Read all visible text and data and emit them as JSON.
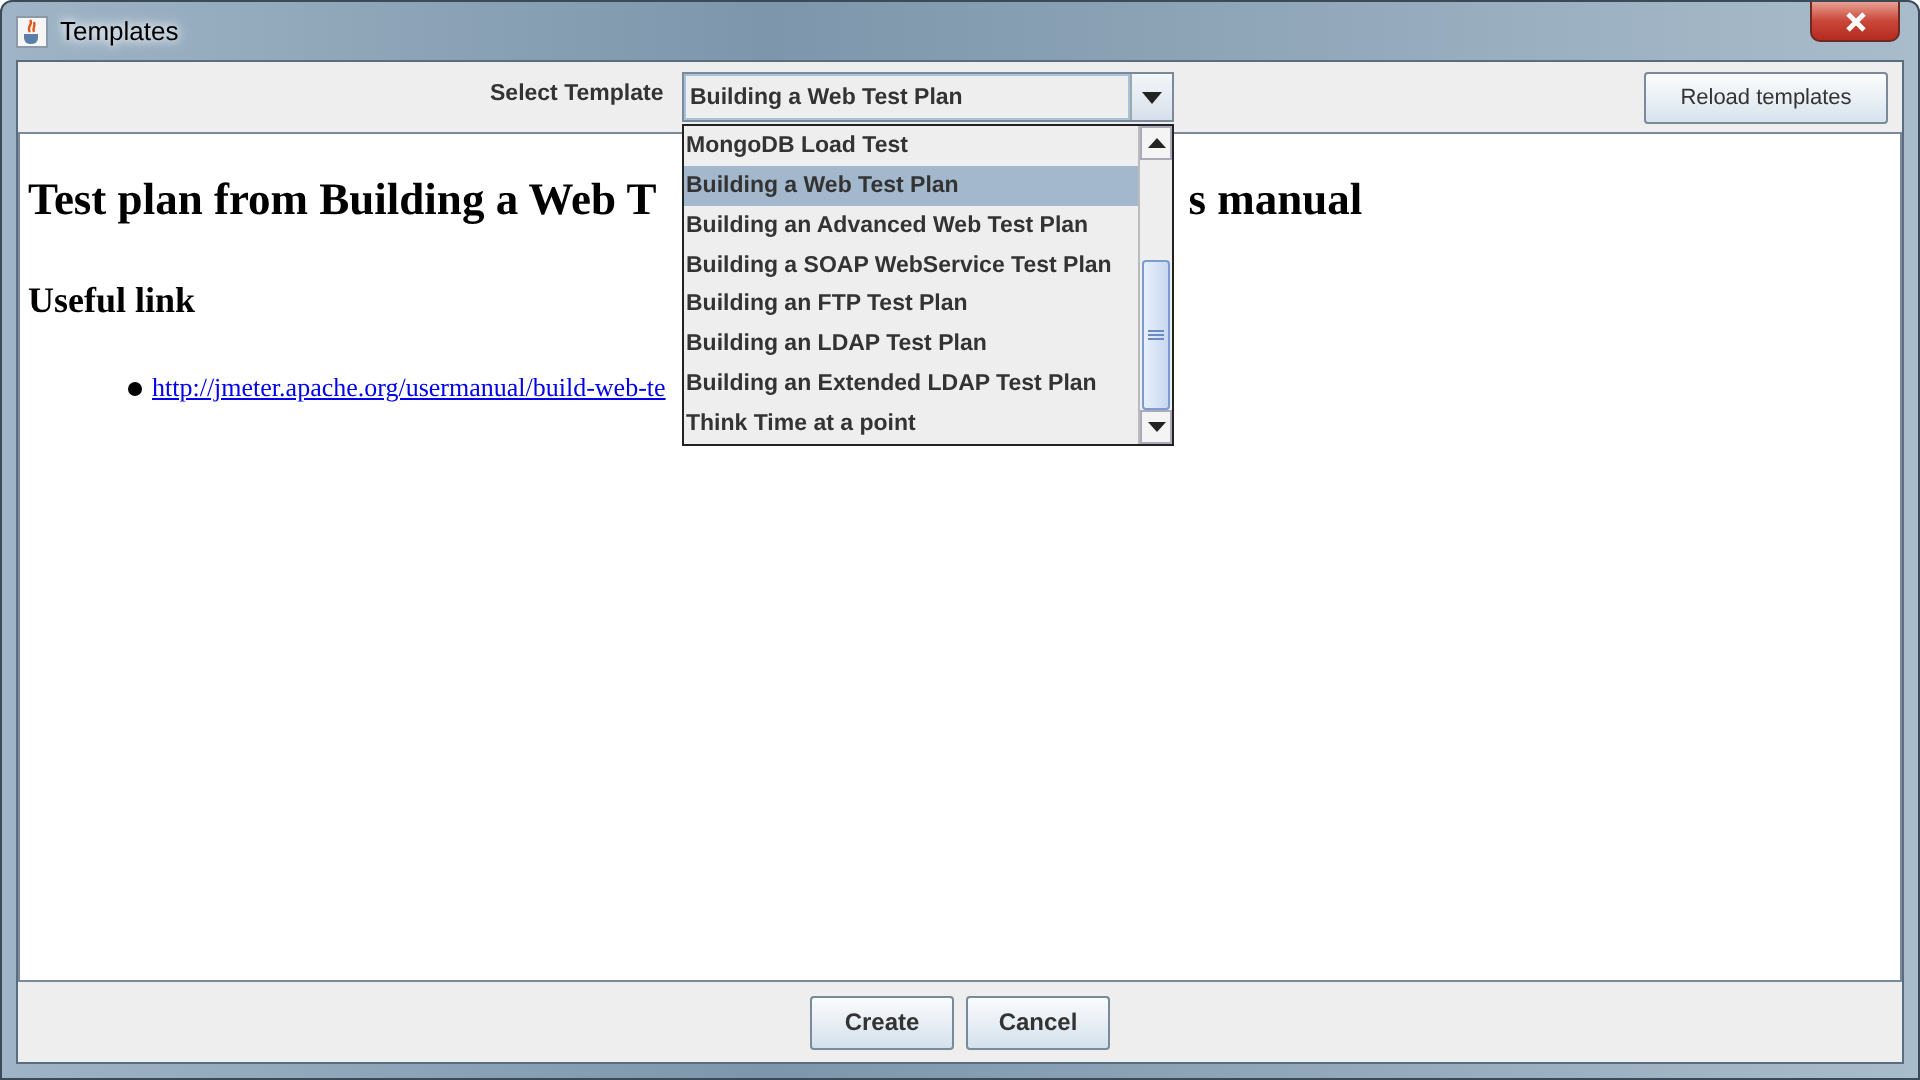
{
  "window": {
    "title": "Templates"
  },
  "toolbar": {
    "label": "Select Template",
    "combo_value": "Building a Web Test Plan",
    "reload_button": "Reload templates"
  },
  "dropdown": {
    "items": [
      {
        "label": "MongoDB Load Test",
        "selected": false
      },
      {
        "label": "Building a Web Test Plan",
        "selected": true
      },
      {
        "label": "Building an Advanced Web Test Plan",
        "selected": false
      },
      {
        "label": "Building a SOAP WebService Test Plan",
        "selected": false
      },
      {
        "label": "Building an FTP Test Plan",
        "selected": false
      },
      {
        "label": "Building an LDAP Test Plan",
        "selected": false
      },
      {
        "label": "Building an Extended LDAP Test Plan",
        "selected": false
      },
      {
        "label": "Think Time at a point",
        "selected": false
      }
    ]
  },
  "content": {
    "heading_parts": [
      "Test plan from Building a Web T",
      "s manual"
    ],
    "subheading": "Useful link",
    "links": [
      "http://jmeter.apache.org/usermanual/build-web-te"
    ]
  },
  "buttons": [
    "Create",
    "Cancel"
  ]
}
